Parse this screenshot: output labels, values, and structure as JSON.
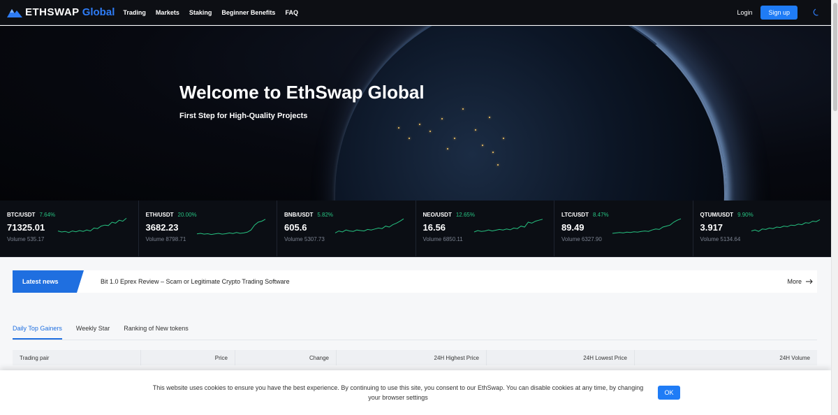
{
  "header": {
    "logo_name": "ETHSWAP",
    "logo_sub": "Global",
    "nav": [
      "Trading",
      "Markets",
      "Staking",
      "Beginner Benefits",
      "FAQ"
    ],
    "login": "Login",
    "signup": "Sign up"
  },
  "hero": {
    "title": "Welcome to EthSwap Global",
    "subtitle": "First Step for High-Quality Projects"
  },
  "tickers": [
    {
      "pair": "BTC/USDT",
      "change": "7.64%",
      "price": "71325.01",
      "volume": "Volume 535.17",
      "spark": [
        0.3,
        0.25,
        0.28,
        0.22,
        0.3,
        0.26,
        0.32,
        0.28,
        0.35,
        0.3,
        0.45,
        0.42,
        0.55,
        0.6,
        0.58,
        0.75,
        0.7,
        0.85,
        0.8,
        0.95
      ]
    },
    {
      "pair": "ETH/USDT",
      "change": "20.00%",
      "price": "3682.23",
      "volume": "Volume 8798.71",
      "spark": [
        0.15,
        0.18,
        0.14,
        0.16,
        0.12,
        0.15,
        0.18,
        0.14,
        0.16,
        0.2,
        0.17,
        0.22,
        0.18,
        0.2,
        0.24,
        0.35,
        0.6,
        0.75,
        0.8,
        0.9
      ]
    },
    {
      "pair": "BNB/USDT",
      "change": "5.82%",
      "price": "605.6",
      "volume": "Volume 5307.73",
      "spark": [
        0.2,
        0.3,
        0.25,
        0.35,
        0.3,
        0.28,
        0.35,
        0.32,
        0.3,
        0.38,
        0.35,
        0.4,
        0.45,
        0.42,
        0.55,
        0.5,
        0.62,
        0.7,
        0.8,
        0.92
      ]
    },
    {
      "pair": "NEO/USDT",
      "change": "12.65%",
      "price": "16.56",
      "volume": "Volume 6850.11",
      "spark": [
        0.25,
        0.32,
        0.28,
        0.3,
        0.35,
        0.3,
        0.34,
        0.38,
        0.35,
        0.4,
        0.36,
        0.45,
        0.42,
        0.55,
        0.5,
        0.75,
        0.7,
        0.8,
        0.85,
        0.9
      ]
    },
    {
      "pair": "LTC/USDT",
      "change": "8.47%",
      "price": "89.49",
      "volume": "Volume 6327.90",
      "spark": [
        0.18,
        0.2,
        0.22,
        0.2,
        0.24,
        0.22,
        0.26,
        0.24,
        0.28,
        0.3,
        0.28,
        0.35,
        0.4,
        0.38,
        0.5,
        0.55,
        0.6,
        0.75,
        0.85,
        0.92
      ]
    },
    {
      "pair": "QTUM/USDT",
      "change": "9.90%",
      "price": "3.917",
      "volume": "Volume 5134.64",
      "spark": [
        0.3,
        0.35,
        0.28,
        0.4,
        0.38,
        0.45,
        0.42,
        0.5,
        0.48,
        0.55,
        0.52,
        0.6,
        0.58,
        0.65,
        0.62,
        0.72,
        0.7,
        0.8,
        0.78,
        0.88
      ]
    }
  ],
  "news": {
    "badge": "Latest news",
    "headline": "Bit 1.0 Eprex Review – Scam or Legitimate Crypto Trading Software",
    "more": "More"
  },
  "tabs": [
    "Daily Top Gainers",
    "Weekly Star",
    "Ranking of New tokens"
  ],
  "table": {
    "columns": [
      "Trading pair",
      "Price",
      "Change",
      "24H Highest Price",
      "24H Lowest Price",
      "24H Volume"
    ]
  },
  "cookie": {
    "text": "This website uses cookies to ensure you have the best experience. By continuing to use this site, you consent to our EthSwap. You can disable cookies at any time, by changing your browser settings",
    "ok": "OK"
  },
  "colors": {
    "accent": "#1f7cf6",
    "positive": "#26c281",
    "header_bg": "#0d0f14"
  }
}
